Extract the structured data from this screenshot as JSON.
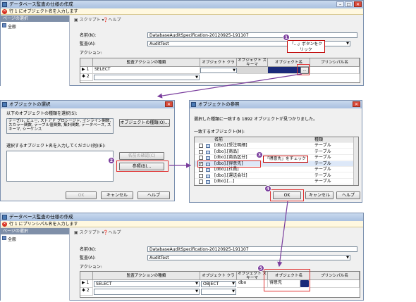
{
  "win1": {
    "title": "データベース監査の仕様の作成",
    "error": "行 1 にオブジェクト名を入力します",
    "side_header": "ページの選択",
    "side_item": "全般",
    "toolbar_script": "スクリプト",
    "toolbar_help": "ヘルプ",
    "name_label": "名前(N):",
    "name_value": "DatabaseAuditSpecification-20120925-191107",
    "audit_label": "監査(A):",
    "audit_value": "AuditTest",
    "actions_label": "アクション:",
    "headers": [
      "監査アクションの種類",
      "オブジェクト クラス",
      "オブジェクト スキーマ",
      "オブジェクト名",
      "プリンシパル名"
    ],
    "rows": [
      {
        "marker": "▶ 1",
        "action": "SELECT"
      },
      {
        "marker": "✱ 2",
        "action": ""
      }
    ],
    "callout": "「...」ボタンをクリック"
  },
  "win2": {
    "title": "オブジェクトの選択",
    "types_label": "以下のオブジェクトの種類を選択(S):",
    "types_value": "テーブル, ビュー, ストアド プロシージャ, インライン関数, スカラー関数, テーブル値関数, 集計関数, データベース, スキーマ, シーケンス",
    "types_button": "オブジェクトの種類(O)...",
    "names_label": "選択するオブジェクト名を入力してください(例)(E):",
    "check_button": "名前の確認(C)",
    "browse_button": "参照(B)...",
    "ok": "OK",
    "cancel": "キャンセル",
    "help": "ヘルプ"
  },
  "win3": {
    "title": "オブジェクトの参照",
    "found": "選択した種類に一致する 1892 オブジェクトが見つかりました。",
    "match_label": "一致するオブジェクト(M):",
    "col_name": "名前",
    "col_type": "種類",
    "items": [
      {
        "name": "[dbo].[受注明細]",
        "type": "テーブル",
        "checked": false
      },
      {
        "name": "[dbo].[商品]",
        "type": "テーブル",
        "checked": false
      },
      {
        "name": "[dbo].[商品区分]",
        "type": "テーブル",
        "checked": false
      },
      {
        "name": "[dbo].[得意先]",
        "type": "テーブル",
        "checked": true
      },
      {
        "name": "[dbo].[社員]",
        "type": "テーブル",
        "checked": false
      },
      {
        "name": "[dbo].[運送会社]",
        "type": "テーブル",
        "checked": false
      },
      {
        "name": "[dbo].[...]",
        "type": "テーブル",
        "checked": false
      }
    ],
    "callout": "「得意先」をチェック",
    "ok": "OK",
    "cancel": "キャンセル",
    "help": "ヘルプ"
  },
  "win4": {
    "title": "データベース監査の仕様の作成",
    "error": "行 1 にプリンシパル名を入力します",
    "side_header": "ページの選択",
    "side_item": "全般",
    "toolbar_script": "スクリプト",
    "toolbar_help": "ヘルプ",
    "name_label": "名前(N):",
    "name_value": "DatabaseAuditSpecification-20120925-191107",
    "audit_label": "監査(A):",
    "audit_value": "AuditTest",
    "actions_label": "アクション:",
    "headers": [
      "監査アクションの種類",
      "オブジェクト クラス",
      "オブジェクト スキーマ",
      "オブジェクト名",
      "プリンシパル名"
    ],
    "rows": [
      {
        "marker": "▶ 1",
        "action": "SELECT",
        "class": "OBJECT",
        "schema": "dbo",
        "object": "得意先"
      },
      {
        "marker": "✱ 2",
        "action": "",
        "class": "",
        "schema": "",
        "object": ""
      }
    ]
  },
  "badges": [
    "1",
    "2",
    "3",
    "4",
    "5"
  ],
  "colors": {
    "badge": "#7a3e9d",
    "highlight": "#e03030",
    "arrow": "#7a3e9d"
  }
}
